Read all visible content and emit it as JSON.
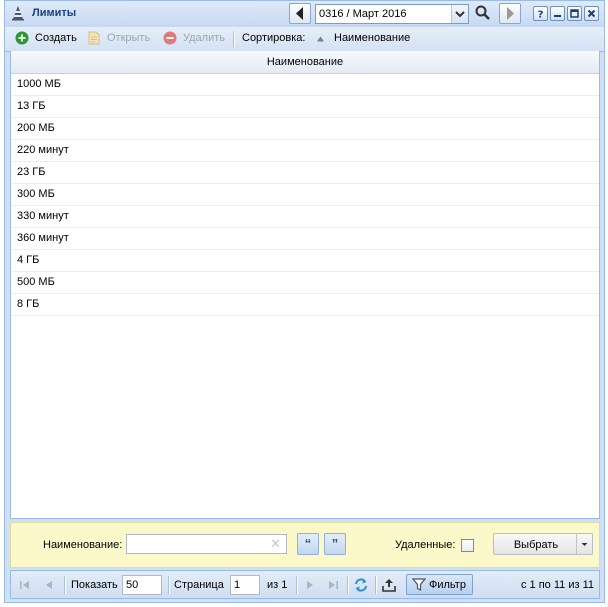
{
  "window": {
    "title": "Лимиты",
    "period": "0316 / Март 2016"
  },
  "toolbar": {
    "create": "Создать",
    "open": "Открыть",
    "delete": "Удалить",
    "sort_label": "Сортировка:",
    "sort_field": "Наименование"
  },
  "grid": {
    "column_header": "Наименование",
    "rows": [
      "1000 МБ",
      "13 ГБ",
      "200 МБ",
      "220 минут",
      "23 ГБ",
      "300 МБ",
      "330 минут",
      "360 минут",
      "4 ГБ",
      "500 МБ",
      "8 ГБ"
    ]
  },
  "filter": {
    "name_label": "Наименование:",
    "name_value": "",
    "deleted_label": "Удаленные:",
    "deleted_checked": false,
    "select_button": "Выбрать"
  },
  "paging": {
    "show_label": "Показать",
    "page_size": "50",
    "page_label": "Страница",
    "current_page": "1",
    "of_pages": "из 1",
    "filter_button": "Фильтр",
    "summary": "с 1 по 11 из 11"
  },
  "colors": {
    "title_text": "#15428b",
    "panel_border": "#99bbe8",
    "filter_background": "#fbf8c9",
    "create_icon": "#2a9a2a",
    "delete_icon": "#e07a7a"
  }
}
